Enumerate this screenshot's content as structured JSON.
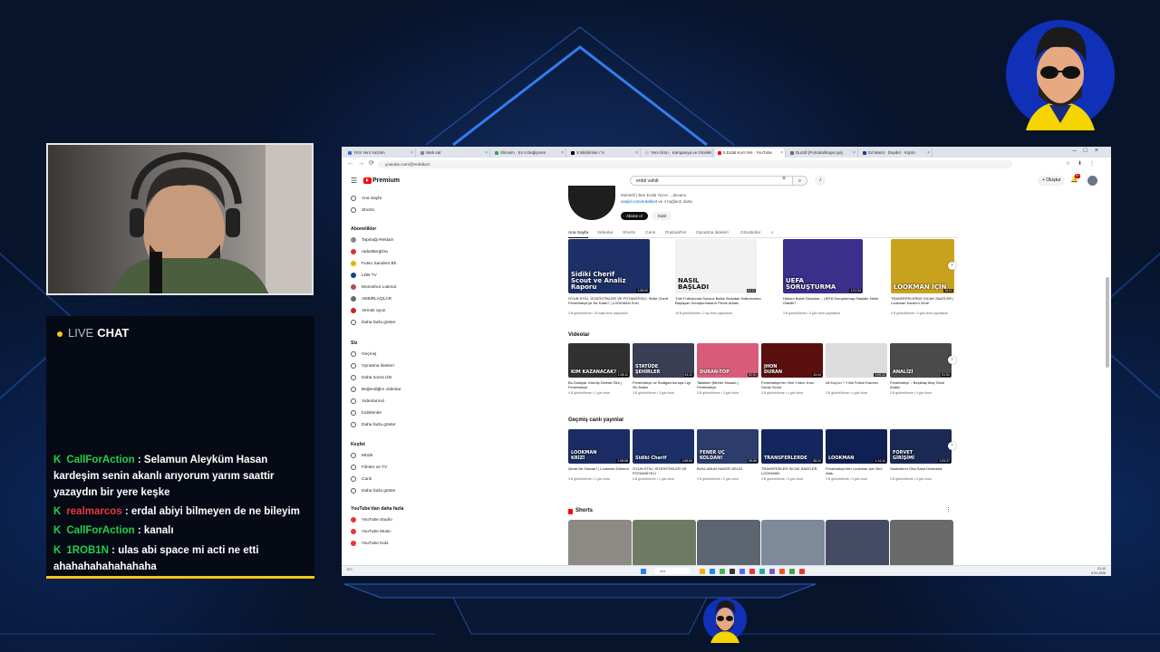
{
  "chat": {
    "header_live": "LIVE",
    "header_chat": "CHAT",
    "messages": [
      {
        "user": "CallForAction",
        "text": ": Selamun Aleyküm Hasan kardeşim senin akanlı arıyorum yarım saattir yazaydın bir yere keşke"
      },
      {
        "user": "realmarcos",
        "text": ": erdal abiyi bilmeyen de ne bileyim"
      },
      {
        "user": "CallForAction",
        "text": ": kanalı"
      },
      {
        "user": "1ROB1N",
        "text": ": ulas abi space mi acti ne etti ahahahahahahahaha"
      }
    ],
    "accent_color": "#f5c518",
    "user_colors": {
      "green": "#1fd14a",
      "red": "#e93a3a"
    }
  },
  "browser": {
    "tabs": [
      "YKS Yeni Yazılım",
      "Web sat",
      "Slimsim · Ev ü Değişmen",
      "X Bildirimler / X",
      "Yeni Ürün · Kampanya ve Ürünler",
      "5 Erdal Kurt-Yeli · YouTube",
      "Duzdil (Portokal/Kapıcıya)",
      "Ed Manti · Daydel · Köprü"
    ],
    "active_tab_index": 5,
    "url": "youtube.com/@erdalkurt"
  },
  "youtube": {
    "logo_text": "Premium",
    "search_value": "erdal vahdi",
    "create_label": "+ Oluştur",
    "notification_count": "9+",
    "sidebar": {
      "top": [
        "Ana Sayfa",
        "Shorts"
      ],
      "subscriptions_title": "Abonelikler",
      "subscriptions": [
        "Tapinaği Reklam",
        "radarBerglOa",
        "Futso Sanders Bh",
        "LDB TV",
        "Monoshur Lokmul",
        "AEBiRLAQLAR",
        "Vemek oyun",
        "Daha fazla göster"
      ],
      "you_title": "Siz",
      "you": [
        "Geçmiş",
        "Oynatma listeleri",
        "Daha sonra izle",
        "Beğendiğim videolar",
        "Videolarınız",
        "İndirilenler",
        "Daha fazla göster"
      ],
      "explore_title": "Keşfet",
      "explore": [
        "Müzik",
        "Filmler ve TV",
        "Canlı",
        "Daha fazla göster"
      ],
      "more_title": "YouTube'dan daha fazla",
      "more": [
        "YouTube Studio",
        "YouTube Music",
        "YouTube Kids"
      ]
    },
    "channel": {
      "meta_line1": "Muhtelif | Ben Erdal Yazıcı ...devamı",
      "meta_link": "sanjid.com/erdalkurt",
      "meta_line2": "ve 4 bağlantı daha",
      "subscribe": "Abone ol",
      "join": "Katıl"
    },
    "channel_tabs": [
      "Ana Sayfa",
      "Videolar",
      "Shorts",
      "Canlı",
      "Podcast'ler",
      "Oynatma listeleri",
      "Gönderiler"
    ],
    "row1": [
      {
        "thumb_text": "Sidiki Cherif\nScout ve Analiz Raporu",
        "duration": "1:08:00",
        "title": "OYUN STİLİ, İSTATİSTİKLER VE POTANSİYELİ: Sidiki Cherif Fenerbahçe'ye Ne Katar? | LOOKMAN Krizi",
        "meta": "3 B görüntüleme • 20 saat önce yayınlandı",
        "bg": "#1c2f66"
      },
      {
        "thumb_text": "NASIL\nBAŞLADI",
        "duration": "43:11",
        "title": "Türk Futbolunda Sonsuz Bahis Skandalı Halkımızdan Başlayan Soruşturmaların Perde Arkası",
        "meta": "18 B görüntüleme • 2 ay önce yayınlandı",
        "bg": "#f1f1f1"
      },
      {
        "thumb_text": "UEFA\nSORUŞTURMA",
        "duration": "1:01:34",
        "title": "Hakem Bahis Skandalı – UEFA Soruşturmayı Başlatır Neler Olabilir?",
        "meta": "3 B görüntüleme • 3 gün önce yayınlandı",
        "bg": "#3a2f8a"
      },
      {
        "thumb_text": "LOOKMAN İÇİN",
        "duration": "15:01",
        "title": "TRANSFERLERDE SICAK SAATLER | Lookman Kararını Verdi",
        "meta": "4 B görüntüleme • 3 gün önce yayınlandı",
        "bg": "#c9a21d"
      }
    ],
    "videos_title": "Videolar",
    "videos": [
      {
        "thumb_text": "KIM KAZANACAK?",
        "duration": "1:08:11",
        "title": "Bu Dolaylar Gümüş Derbisi Ölür | Fenerbahçe",
        "meta": "4 B görüntüleme • 1 gün önce",
        "bg": "#303030"
      },
      {
        "thumb_text": "STATÜDE\nŞEHİRLER",
        "duration": "44:11",
        "title": "Fenerbahçe ve Stuttgart Avrupa Ligi Ön Analiz",
        "meta": "3 B görüntüleme • 3 gün önce",
        "bg": "#3b3f55"
      },
      {
        "thumb_text": "DURAN-TOP",
        "duration": "52:51",
        "title": "Taktikleri Şifreler Musadı | Fenerbahçe",
        "meta": "3 B görüntüleme • 3 gün önce",
        "bg": "#d85c7a"
      },
      {
        "thumb_text": "JHON\nDURAN",
        "duration": "43:44",
        "title": "Fenerbahçe'nin Yeni Yıldızı Jhon Duran Scout",
        "meta": "3 B görüntüleme • 4 gün önce",
        "bg": "#5b1010"
      },
      {
        "thumb_text": "",
        "duration": "1:09:12",
        "title": "Ali Koç'un 7 Yıllık Futbol Karnesi",
        "meta": "3 B görüntüleme • 4 gün önce",
        "bg": "#dcdcdc"
      },
      {
        "thumb_text": "ANALİZİ",
        "duration": "51:51",
        "title": "Fenerbahçe – Beşiktaş Maç Öncü Analiz",
        "meta": "3 B görüntüleme • 4 gün önce",
        "bg": "#4a4a4a"
      }
    ],
    "past_live_title": "Geçmiş canlı yayınlar",
    "past_live": [
      {
        "thumb_text": "LOOKMAN\nKRİZİ",
        "duration": "1:08:55",
        "title": "Şimdi Ne Olacak? | Lookman Dönemi",
        "meta": "3 B görüntüleme • 1 gün önce",
        "bg": "#1a2c63"
      },
      {
        "thumb_text": "Sidiki Cherif",
        "duration": "1:08:00",
        "title": "OYUN STİLİ, İSTATİSTİKLER VE POTANSİYELİ",
        "meta": "3 B görüntüleme • 1 gün önce",
        "bg": "#1c2f66"
      },
      {
        "thumb_text": "FENER UÇ\nKOLDAN!",
        "duration": "59:58",
        "title": "BUKLUNUN HAKER GELDİ",
        "meta": "3 B görüntüleme • 2 gün önce",
        "bg": "#2c3d6b"
      },
      {
        "thumb_text": "TRANSFERLERDE",
        "duration": "58:24",
        "title": "TRANSFERLER SICAK SAATLER LOOKMAN",
        "meta": "3 B görüntüleme • 3 gün önce",
        "bg": "#13275e"
      },
      {
        "thumb_text": "LOOKMAN",
        "duration": "1:14:10",
        "title": "Fenerbahçe'den Lookman İçin Yeni Atak",
        "meta": "3 B görüntüleme • 3 gün önce",
        "bg": "#0f2052"
      },
      {
        "thumb_text": "FORVET\nGİRİŞİMİ",
        "duration": "1:03:37",
        "title": "Santraforın Orta Saha Desteksiz",
        "meta": "3 B görüntüleme • 4 gün önce",
        "bg": "#1a2a55"
      }
    ],
    "shorts_title": "Shorts"
  },
  "taskbar": {
    "search_placeholder": "Ara",
    "clock_time": "21:10",
    "clock_date": "6.01.2026",
    "weather": "6°C"
  }
}
